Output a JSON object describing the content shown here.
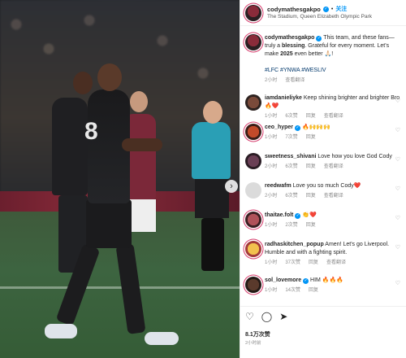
{
  "header": {
    "username": "codymathesgakpo",
    "follow_label": "关注",
    "location": "The Stadium, Queen Elizabeth Olympic Park"
  },
  "photo": {
    "jersey_number": "8",
    "next_icon": "chevron-right-icon"
  },
  "caption": {
    "username": "codymathesgakpo",
    "text_part1": "This team, and these fans—truly a ",
    "bold1": "blessing",
    "text_part2": ". Grateful for every moment. Let's make ",
    "bold2": "2025",
    "text_part3": " even better 🙏🏻!",
    "hashtags": "#LFC #YNWA #WESLIV",
    "time": "2小时",
    "translate": "查看翻译"
  },
  "comments": [
    {
      "username": "iamdanieliyke",
      "text": "Keep shining brighter and brighter Bro 🔥❤️",
      "time": "1小时",
      "likes": "6次赞",
      "reply": "回复",
      "translate": "查看翻译"
    },
    {
      "username": "ceo_hyper",
      "verified": true,
      "text": "🔥🙌🙌🙌",
      "time": "1小时",
      "likes": "7次赞",
      "reply": "回复"
    },
    {
      "username": "sweetness_shivani",
      "text": "Love how you love God Cody",
      "time": "2小时",
      "likes": "6次赞",
      "reply": "回复",
      "translate": "查看翻译"
    },
    {
      "username": "reedwafm",
      "text": "Love you so much Cody❤️",
      "time": "2小时",
      "likes": "6次赞",
      "reply": "回复",
      "translate": "查看翻译"
    },
    {
      "username": "thaitae.folt",
      "verified": true,
      "text": "👏❤️",
      "time": "1小时",
      "likes": "2次赞",
      "reply": "回复"
    },
    {
      "username": "radhaskitchen_popup",
      "text": "Amen! Let's go Liverpool. Humble and with a fighting spirit.",
      "time": "1小时",
      "likes": "37次赞",
      "reply": "回复",
      "translate": "查看翻译"
    },
    {
      "username": "sol_lovemore",
      "verified": true,
      "text": "HIM 🔥🔥🔥",
      "time": "1小时",
      "likes": "14次赞",
      "reply": "回复"
    }
  ],
  "actions": {
    "likes": "8.1万次赞",
    "posted": "2小时前"
  }
}
